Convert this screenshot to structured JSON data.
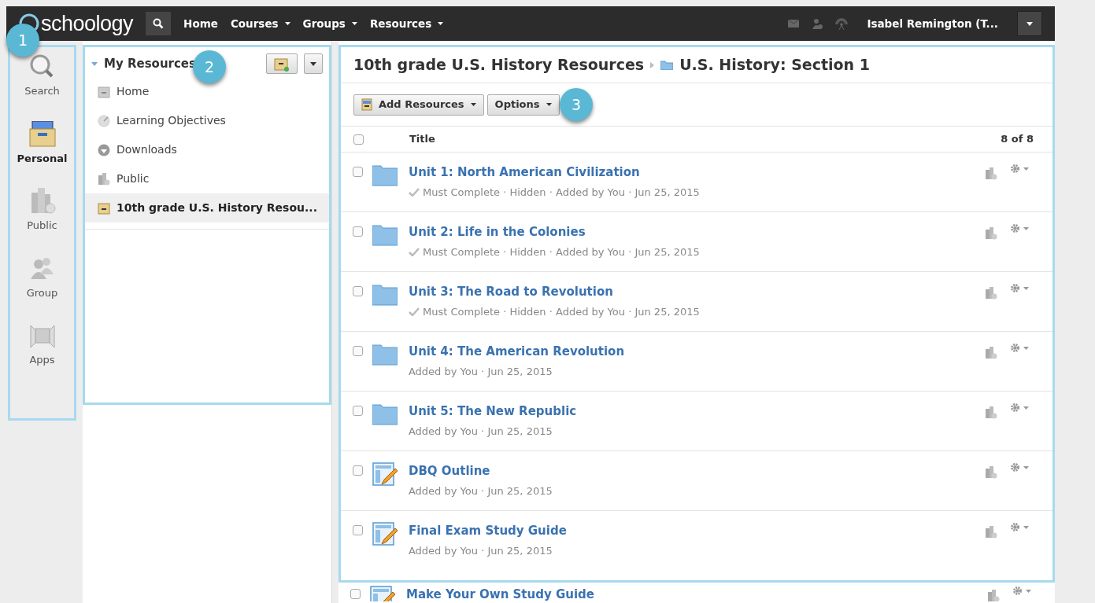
{
  "topbar": {
    "logo": "schoology",
    "nav": [
      {
        "label": "Home",
        "dropdown": false
      },
      {
        "label": "Courses",
        "dropdown": true
      },
      {
        "label": "Groups",
        "dropdown": true
      },
      {
        "label": "Resources",
        "dropdown": true
      }
    ],
    "user": "Isabel Remington (T..."
  },
  "rail": [
    {
      "label": "Search",
      "kind": "search",
      "selected": false
    },
    {
      "label": "Personal",
      "kind": "personal",
      "selected": true
    },
    {
      "label": "Public",
      "kind": "public",
      "selected": false
    },
    {
      "label": "Group",
      "kind": "group",
      "selected": false
    },
    {
      "label": "Apps",
      "kind": "apps",
      "selected": false
    }
  ],
  "resources": {
    "title": "My Resources",
    "expanded": true,
    "items": [
      {
        "label": "Home",
        "kind": "home",
        "selected": false
      },
      {
        "label": "Learning Objectives",
        "kind": "objectives",
        "selected": false
      },
      {
        "label": "Downloads",
        "kind": "downloads",
        "selected": false
      },
      {
        "label": "Public",
        "kind": "public",
        "selected": false
      },
      {
        "label": "10th grade U.S. History Resou...",
        "kind": "collection",
        "selected": true
      }
    ]
  },
  "breadcrumb": {
    "parent": "10th grade U.S. History Resources",
    "current": "U.S. History: Section 1"
  },
  "toolbar": [
    "Add Resources",
    "Options"
  ],
  "table": {
    "all_checked": false,
    "column": "Title",
    "count": "8 of 8",
    "rows": [
      {
        "title": "Unit 1: North American Civilization",
        "kind": "folder",
        "checked": false,
        "must_complete": true,
        "meta": "Must Complete · Hidden · Added by You · Jun 25, 2015"
      },
      {
        "title": "Unit 2: Life in the Colonies",
        "kind": "folder",
        "checked": false,
        "must_complete": true,
        "meta": "Must Complete · Hidden · Added by You · Jun 25, 2015"
      },
      {
        "title": "Unit 3: The Road to Revolution",
        "kind": "folder",
        "checked": false,
        "must_complete": true,
        "meta": "Must Complete · Hidden · Added by You · Jun 25, 2015"
      },
      {
        "title": "Unit 4: The American Revolution",
        "kind": "folder",
        "checked": false,
        "must_complete": false,
        "meta": "Added by You · Jun 25, 2015"
      },
      {
        "title": "Unit 5: The New Republic",
        "kind": "folder",
        "checked": false,
        "must_complete": false,
        "meta": "Added by You · Jun 25, 2015"
      },
      {
        "title": "DBQ Outline",
        "kind": "page",
        "checked": false,
        "must_complete": false,
        "meta": "Added by You · Jun 25, 2015"
      },
      {
        "title": "Final Exam Study Guide",
        "kind": "page",
        "checked": false,
        "must_complete": false,
        "meta": "Added by You · Jun 25, 2015"
      },
      {
        "title": "Make Your Own Study Guide",
        "kind": "page",
        "checked": false
      }
    ]
  },
  "callouts": [
    "1",
    "2",
    "3"
  ]
}
